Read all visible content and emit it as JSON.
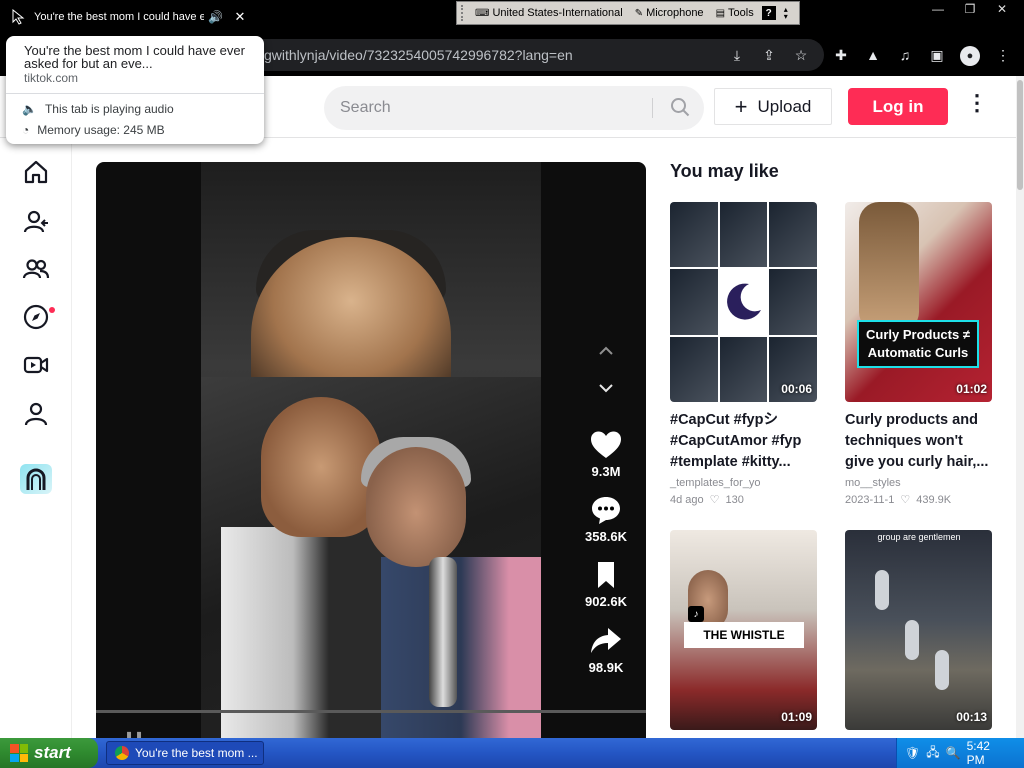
{
  "browser": {
    "tab": {
      "title": "You're the best mom I could have ever asked for but an even better grandma"
    },
    "url_visible": "gwithlynja/video/7323254005742996782?lang=en",
    "hover_card": {
      "title": "You're the best mom I could have ever asked for but an eve...",
      "domain": "tiktok.com",
      "audio": "This tab is playing audio",
      "memory": "Memory usage: 245 MB"
    }
  },
  "language_bar": {
    "language": "United States-International",
    "microphone": "Microphone",
    "tools": "Tools",
    "help": "?"
  },
  "header": {
    "search_placeholder": "Search",
    "upload_label": "Upload",
    "login_label": "Log in"
  },
  "video": {
    "likes": "9.3M",
    "comments": "358.6K",
    "saves": "902.6K",
    "shares": "98.9K",
    "progress": 0
  },
  "recommendations": {
    "title": "You may like",
    "items": [
      {
        "desc": "#CapCut #fypシ #CapCutAmor #fyp #template #kitty...",
        "author": "_templates_for_yo",
        "date": "4d ago",
        "likes": "130",
        "duration": "00:06",
        "overlay": ""
      },
      {
        "desc": "Curly products and techniques won't give you curly hair,...",
        "author": "mo__styles",
        "date": "2023-11-1",
        "likes": "439.9K",
        "duration": "01:02",
        "overlay": "Curly Products ≠ Automatic Curls"
      },
      {
        "desc": "",
        "author": "",
        "date": "",
        "likes": "",
        "duration": "01:09",
        "overlay": "THE WHISTLE"
      },
      {
        "desc": "",
        "author": "",
        "date": "",
        "likes": "",
        "duration": "00:13",
        "overlay": "group are gentlemen"
      }
    ]
  },
  "taskbar": {
    "start_label": "start",
    "task_label": "You're the best mom ...",
    "clock": "5:42 PM"
  },
  "colors": {
    "accent": "#fe2c55",
    "taskbar": "#2456c4",
    "start": "#2f8a2f"
  }
}
